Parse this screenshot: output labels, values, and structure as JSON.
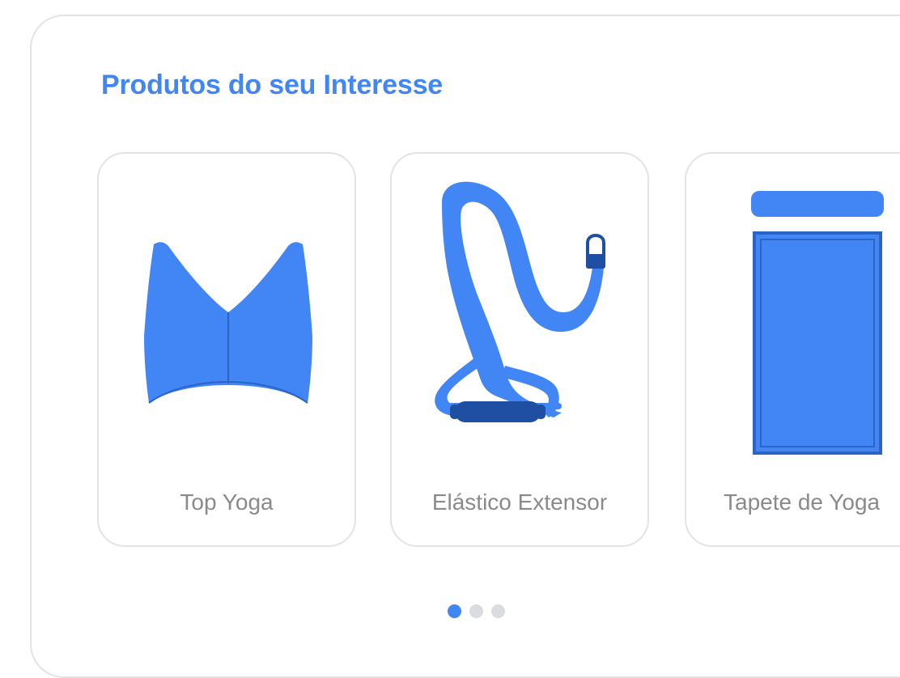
{
  "section": {
    "title": "Produtos do seu Interesse"
  },
  "products": [
    {
      "label": "Top Yoga",
      "icon": "sports-bra-icon"
    },
    {
      "label": "Elástico Extensor",
      "icon": "resistance-band-icon"
    },
    {
      "label": "Tapete de Yoga",
      "icon": "yoga-mat-icon"
    }
  ],
  "pagination": {
    "pages": 3,
    "active": 1
  },
  "colors": {
    "accent": "#4285f4",
    "accent_dark": "#1f4fa3",
    "label_gray": "#8a8a8a",
    "border": "#e3e3e3",
    "dot_inactive": "#dadce0"
  }
}
